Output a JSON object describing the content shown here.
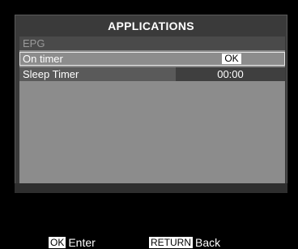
{
  "window": {
    "title": "APPLICATIONS"
  },
  "menu": {
    "rows": [
      {
        "label": "EPG",
        "value": ""
      },
      {
        "label": "On timer",
        "value": "OK"
      },
      {
        "label": "Sleep Timer",
        "value": "00:00"
      }
    ],
    "selected_index": 1
  },
  "footer": {
    "hints": [
      {
        "key": "OK",
        "action": "Enter"
      },
      {
        "key": "RETURN",
        "action": "Back"
      }
    ]
  },
  "colors": {
    "background": "#000000",
    "panel": "#8c8c8c",
    "selection_border": "#e6e6e6",
    "text": "#ffffff"
  }
}
